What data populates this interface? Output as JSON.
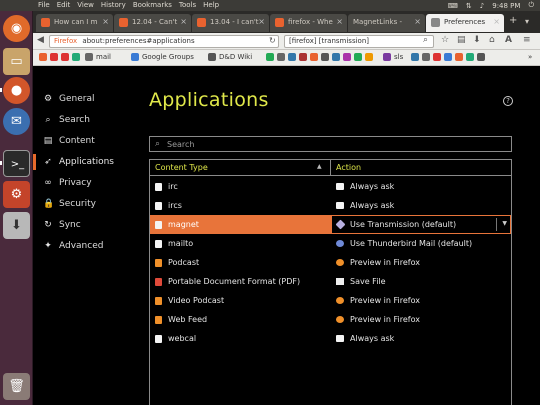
{
  "menubar": {
    "items": [
      "File",
      "Edit",
      "View",
      "History",
      "Bookmarks",
      "Tools",
      "Help"
    ],
    "time": "9:48 PM"
  },
  "tabs": [
    {
      "label": "How can I m"
    },
    {
      "label": "12.04 - Can't"
    },
    {
      "label": "13.04 - I can't"
    },
    {
      "label": "firefox - Whe"
    },
    {
      "label": "MagnetLinks - "
    },
    {
      "label": "Preferences",
      "active": true
    }
  ],
  "navbar": {
    "identity": "Firefox",
    "url": "about:preferences#applications",
    "search": "[firefox] [transmission]"
  },
  "bookmarks": [
    "mail",
    "Google Groups",
    "D&D Wiki",
    "sls"
  ],
  "sidebar": {
    "items": [
      {
        "label": "General",
        "icon": "gear-icon"
      },
      {
        "label": "Search",
        "icon": "search-icon"
      },
      {
        "label": "Content",
        "icon": "document-icon"
      },
      {
        "label": "Applications",
        "icon": "rocket-icon",
        "selected": true
      },
      {
        "label": "Privacy",
        "icon": "mask-icon"
      },
      {
        "label": "Security",
        "icon": "lock-icon"
      },
      {
        "label": "Sync",
        "icon": "sync-icon"
      },
      {
        "label": "Advanced",
        "icon": "wizard-icon"
      }
    ]
  },
  "page": {
    "title": "Applications",
    "help": "?"
  },
  "search": {
    "placeholder": "Search"
  },
  "table": {
    "headers": {
      "content_type": "Content Type",
      "action": "Action"
    },
    "rows": [
      {
        "type": "irc",
        "action": "Always ask"
      },
      {
        "type": "ircs",
        "action": "Always ask"
      },
      {
        "type": "magnet",
        "action": "Use Transmission (default)",
        "selected": true
      },
      {
        "type": "mailto",
        "action": "Use Thunderbird Mail (default)"
      },
      {
        "type": "Podcast",
        "action": "Preview in Firefox"
      },
      {
        "type": "Portable Document Format (PDF)",
        "action": "Save File"
      },
      {
        "type": "Video Podcast",
        "action": "Preview in Firefox"
      },
      {
        "type": "Web Feed",
        "action": "Preview in Firefox"
      },
      {
        "type": "webcal",
        "action": "Always ask"
      }
    ]
  }
}
